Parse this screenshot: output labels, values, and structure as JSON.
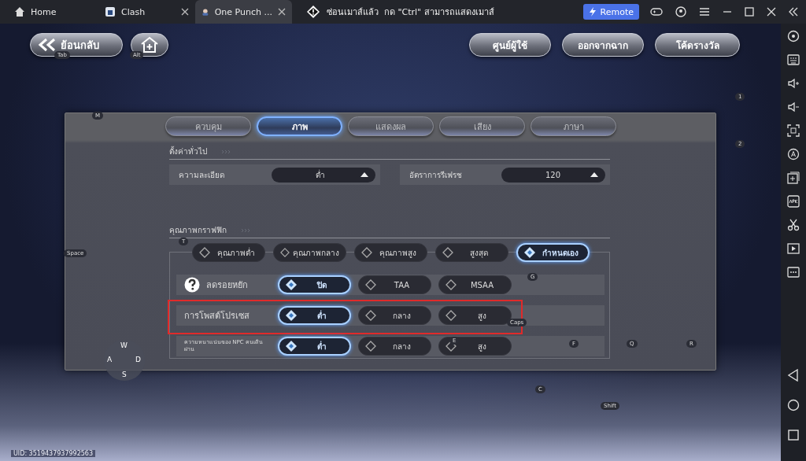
{
  "browser_tabs": [
    {
      "label": "Home",
      "kind": "home",
      "selected": false
    },
    {
      "label": "Clash",
      "kind": "app",
      "selected": false
    },
    {
      "label": "One Punch ...",
      "kind": "game",
      "selected": true
    }
  ],
  "notice": "ซ่อนเมาส์แล้ว  กด \"Ctrl\" สามารถแสดงเมาส์",
  "remote_button": "Remote",
  "back_button": {
    "label": "ย้อนกลับ",
    "hint": "Tab"
  },
  "home_button": {
    "hint": "Alt"
  },
  "top_buttons": [
    "ศูนย์ผู้ใช้",
    "ออกจากฉาก",
    "โค้ดรางวัล"
  ],
  "settings_tabs": [
    {
      "label": "ควบคุม",
      "selected": false
    },
    {
      "label": "ภาพ",
      "selected": true
    },
    {
      "label": "แสดงผล",
      "selected": false
    },
    {
      "label": "เสียง",
      "selected": false
    },
    {
      "label": "ภาษา",
      "selected": false
    }
  ],
  "general": {
    "title": "ตั้งค่าทั่วไป",
    "dropdowns": [
      {
        "label": "ความละเอียด",
        "value": "ต่ำ"
      },
      {
        "label": "อัตราการรีเฟรช",
        "value": "120"
      }
    ]
  },
  "graphics": {
    "title": "คุณภาพกราฟฟิก",
    "presets": [
      {
        "label": "คุณภาพต่ำ",
        "selected": false
      },
      {
        "label": "คุณภาพกลาง",
        "selected": false
      },
      {
        "label": "คุณภาพสูง",
        "selected": false
      },
      {
        "label": "สูงสุด",
        "selected": false
      },
      {
        "label": "กำหนดเอง",
        "selected": true
      }
    ],
    "rows": [
      {
        "label": "ลดรอยหยัก",
        "help": true,
        "highlighted": false,
        "options": [
          {
            "label": "ปิด",
            "selected": true
          },
          {
            "label": "TAA",
            "selected": false
          },
          {
            "label": "MSAA",
            "selected": false
          }
        ]
      },
      {
        "label": "การโพสต์โปรเซส",
        "help": false,
        "highlighted": true,
        "options": [
          {
            "label": "ต่ำ",
            "selected": true
          },
          {
            "label": "กลาง",
            "selected": false
          },
          {
            "label": "สูง",
            "selected": false
          }
        ]
      },
      {
        "label": "ความหนาแน่นของ NPC คนเดินผ่าน",
        "help": false,
        "highlighted": false,
        "options": [
          {
            "label": "ต่ำ",
            "selected": true
          },
          {
            "label": "กลาง",
            "selected": false
          },
          {
            "label": "สูง",
            "selected": false
          }
        ]
      }
    ]
  },
  "key_hints": [
    "M",
    "1",
    "2",
    "Space",
    "T",
    "G",
    "Caps",
    "E",
    "F",
    "Q",
    "R",
    "C",
    "Shift"
  ],
  "joystick": {
    "up": "W",
    "left": "A",
    "right": "D",
    "down": "S"
  },
  "uid": "UID: 3519437937992563"
}
